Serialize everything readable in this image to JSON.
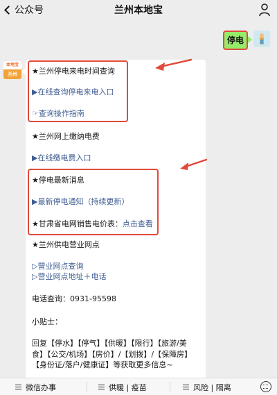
{
  "nav": {
    "back_label": "公众号",
    "title": "兰州本地宝"
  },
  "outgoing": {
    "text": "停电"
  },
  "bot_avatar": {
    "top": "本地宝",
    "bottom": "兰州"
  },
  "message": {
    "lines": [
      {
        "text": "★兰州停电来电时间查询",
        "link": false
      },
      {
        "text": "▶在线查询停电来电入口",
        "link": true
      },
      {
        "text": "☞查询操作指南",
        "link": true
      },
      {
        "text": "★兰州网上缴纳电费",
        "link": false
      },
      {
        "text": "▶在线缴电费入口",
        "link": true
      },
      {
        "text": "★停电最新消息",
        "link": false
      },
      {
        "text": "▶最新停电通知（持续更新）",
        "link": true
      },
      {
        "prefix": "★甘肃省电网销售电价表：",
        "link_text": "点击查看"
      },
      {
        "text": "★兰州供电营业网点",
        "link": false
      },
      {
        "text": "▷营业网点查询",
        "link": true
      },
      {
        "text": "▷营业网点地址＋电话",
        "link": true
      },
      {
        "text": "电话查询：0931-95598",
        "link": false
      },
      {
        "text": "小贴士：",
        "link": false
      },
      {
        "text": "回复【停水】【停气】【供暖】【限行】【旅游/美",
        "link": false
      },
      {
        "text": "食】【公交/机场】【房价】/【划拨】/【保障房】",
        "link": false
      },
      {
        "text": "【身份证/落户/健康证】等获取更多信息~",
        "link": false
      }
    ]
  },
  "toolbar": {
    "tabs": [
      {
        "label": "微信办事"
      },
      {
        "label": "供暖 | 疫苗"
      },
      {
        "label": "风险 | 隔离"
      }
    ]
  },
  "colors": {
    "accent": "#e24a3b",
    "link": "#3f5d93",
    "bubble_out": "#95ec69"
  },
  "icons": [
    "back-chevron-icon",
    "user-icon",
    "menu-icon",
    "keyboard-icon"
  ]
}
